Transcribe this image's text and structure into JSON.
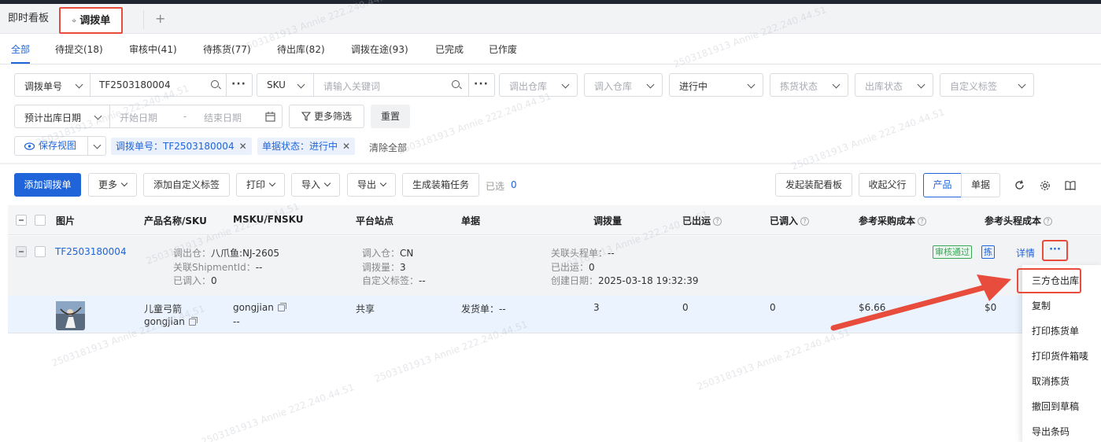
{
  "tabs": {
    "dashboard": "即时看板",
    "transfer": "调拨单",
    "add": "+"
  },
  "status_tabs": [
    "全部",
    "待提交(18)",
    "审核中(41)",
    "待拣货(77)",
    "待出库(82)",
    "调拨在途(93)",
    "已完成",
    "已作废"
  ],
  "filters": {
    "transfer_no_label": "调拨单号",
    "transfer_no_value": "TF2503180004",
    "sku_label": "SKU",
    "sku_placeholder": "请输入关键词",
    "out_warehouse": "调出仓库",
    "in_warehouse": "调入仓库",
    "progress": "进行中",
    "pick_status": "拣货状态",
    "out_status": "出库状态",
    "custom_tag": "自定义标签",
    "date_type": "预计出库日期",
    "start_date": "开始日期",
    "date_sep": "-",
    "end_date": "结束日期",
    "more_filter": "更多筛选",
    "reset": "重置",
    "save_view": "保存视图",
    "chip1": "调拨单号：TF2503180004",
    "chip2": "单据状态：进行中",
    "clear_all": "清除全部"
  },
  "toolbar": {
    "add": "添加调拨单",
    "more": "更多",
    "add_tag": "添加自定义标签",
    "print": "打印",
    "import": "导入",
    "export": "导出",
    "gen_box": "生成装箱任务",
    "selected_label": "已选",
    "selected_count": "0",
    "board": "发起装配看板",
    "collect": "收起父行",
    "product": "产品",
    "document": "单据"
  },
  "columns": [
    "图片",
    "产品名称/SKU",
    "MSKU/FNSKU",
    "平台站点",
    "单据",
    "调拨量",
    "已出运",
    "已调入",
    "参考采购成本",
    "参考头程成本"
  ],
  "order": {
    "no": "TF2503180004",
    "out_wh_label": "调出仓：",
    "out_wh": "八爪鱼:NJ-2605",
    "shipment_label": "关联ShipmentId：",
    "shipment": "--",
    "in_qty_label": "已调入：",
    "in_qty": "0",
    "in_wh_label": "调入仓：",
    "in_wh": "CN",
    "transfer_qty_label": "调拨量：",
    "transfer_qty": "3",
    "tag_label": "自定义标签：",
    "tag": "--",
    "head_label": "关联头程单：",
    "head": "--",
    "shipped_label": "已出运：",
    "shipped": "0",
    "created_label": "创建日期：",
    "created": "2025-03-18 19:32:39",
    "badge_approved": "审核通过",
    "badge_pick": "拣",
    "detail": "详情",
    "more": "···"
  },
  "product": {
    "name": "儿童弓箭",
    "sku": "gongjian",
    "msku": "gongjian",
    "fnsku": "--",
    "site": "共享",
    "doc_label": "发货单：",
    "doc": "--",
    "qty": "3",
    "shipped": "0",
    "received": "0",
    "purchase_cost": "$6.66",
    "head_cost": "$0"
  },
  "menu": [
    "三方仓出库",
    "复制",
    "打印拣货单",
    "打印货件箱唛",
    "取消拣货",
    "撤回到草稿",
    "导出条码"
  ],
  "watermark": "2503181913 Annie 222.240.44.51",
  "colors": {
    "primary": "#1f64d8",
    "highlight": "#e74c3c",
    "approved": "#3aa757"
  }
}
